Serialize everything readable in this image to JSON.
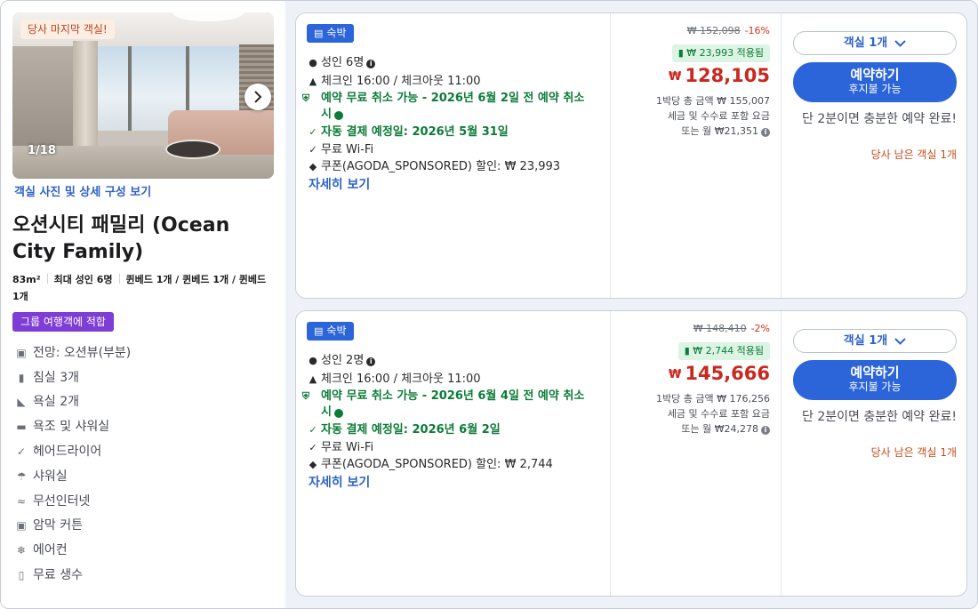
{
  "room": {
    "last_room_badge": "당사 마지막 객실!",
    "photo_counter": "1/18",
    "photo_link": "객실 사진 및 상세 구성 보기",
    "title": "오션시티 패밀리 (Ocean City Family)",
    "specs": {
      "area": "83m²",
      "max_guests": "최대 성인 6명",
      "beds": "퀸베드 1개 / 퀸베드 1개 / 퀸베드 1개"
    },
    "group_badge": "그룹 여행객에 적합",
    "amenities": [
      {
        "icon": "view-icon",
        "label": "전망: 오션뷰(부분)"
      },
      {
        "icon": "bedroom-icon",
        "label": "침실 3개"
      },
      {
        "icon": "bathroom-icon",
        "label": "욕실 2개"
      },
      {
        "icon": "bathtub-icon",
        "label": "욕조 및 샤워실"
      },
      {
        "icon": "check-icon",
        "label": "헤어드라이어"
      },
      {
        "icon": "shower-icon",
        "label": "샤워실"
      },
      {
        "icon": "wifi-icon",
        "label": "무선인터넷"
      },
      {
        "icon": "curtain-icon",
        "label": "암막 커튼"
      },
      {
        "icon": "snowflake-icon",
        "label": "에어컨"
      },
      {
        "icon": "water-bottle-icon",
        "label": "무료 생수"
      }
    ]
  },
  "offers": [
    {
      "tag": "숙박",
      "guests": "성인 6명",
      "checkin": "체크인 16:00 / 체크아웃 11:00",
      "free_cancel": "예약 무료 취소 가능 - 2026년 6월 2일 전 예약 취소 시",
      "auto_pay": "자동 결제 예정일: 2026년 5월 31일",
      "wifi": "무료 Wi-Fi",
      "coupon": "쿠폰(AGODA_SPONSORED) 할인: ₩ 23,993",
      "more": "자세히 보기",
      "original_price": "₩ 152,098",
      "discount_pct": "-16%",
      "coupon_applied": "₩ 23,993 적용됨",
      "currency": "₩",
      "price": "128,105",
      "total_line": "1박당 총 금액 ₩ 155,007",
      "tax_line": "세금 및 수수료 포함 요금",
      "monthly_line": "또는 월 ₩21,351",
      "room_select": "객실 1개",
      "book_label": "예약하기",
      "pay_later": "후지불 가능",
      "urgency": "단 2분이면 충분한 예약 완료!",
      "rooms_left": "당사 남은 객실 1개"
    },
    {
      "tag": "숙박",
      "guests": "성인 2명",
      "checkin": "체크인 16:00 / 체크아웃 11:00",
      "free_cancel": "예약 무료 취소 가능 - 2026년 6월 4일 전 예약 취소 시",
      "auto_pay": "자동 결제 예정일: 2026년 6월 2일",
      "wifi": "무료 Wi-Fi",
      "coupon": "쿠폰(AGODA_SPONSORED) 할인: ₩ 2,744",
      "more": "자세히 보기",
      "original_price": "₩ 148,410",
      "discount_pct": "-2%",
      "coupon_applied": "₩ 2,744 적용됨",
      "currency": "₩",
      "price": "145,666",
      "total_line": "1박당 총 금액 ₩ 176,256",
      "tax_line": "세금 및 수수료 포함 요금",
      "monthly_line": "또는 월 ₩24,278",
      "room_select": "객실 1개",
      "book_label": "예약하기",
      "pay_later": "후지불 가능",
      "urgency": "단 2분이면 충분한 예약 완료!",
      "rooms_left": "당사 남은 객실 1개"
    }
  ],
  "colors": {
    "accent": "#2b65d9",
    "price": "#c8281e",
    "green": "#0c7b37",
    "group": "#7e3dd5"
  }
}
